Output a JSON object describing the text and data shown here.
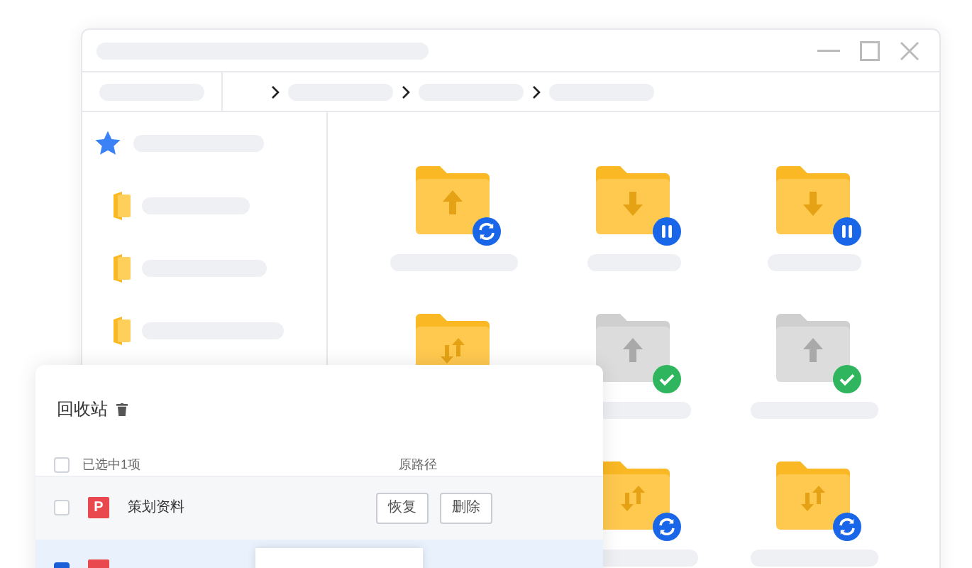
{
  "sidebar": {
    "items": [
      {
        "kind": "starred"
      },
      {
        "kind": "folder"
      },
      {
        "kind": "folder"
      },
      {
        "kind": "folder"
      }
    ]
  },
  "folders": [
    {
      "kind": "upload",
      "syncing": true,
      "paused": false,
      "done": false
    },
    {
      "kind": "download",
      "syncing": false,
      "paused": true,
      "done": false
    },
    {
      "kind": "download",
      "syncing": false,
      "paused": true,
      "done": false
    },
    {
      "kind": "transfer",
      "syncing": false,
      "paused": false,
      "done": false
    },
    {
      "kind": "upload",
      "syncing": false,
      "paused": false,
      "done": true
    },
    {
      "kind": "upload",
      "syncing": false,
      "paused": false,
      "done": true
    },
    {
      "kind": "transfer",
      "syncing": true,
      "paused": false,
      "done": false
    },
    {
      "kind": "transfer",
      "syncing": true,
      "paused": false,
      "done": false
    }
  ],
  "recycle_bin": {
    "title": "回收站",
    "header": {
      "label": "已选中1项",
      "checked": false,
      "path_label": "原路径"
    },
    "rows": [
      {
        "name": "策划资料",
        "badge": "P",
        "checked": false,
        "selected": false,
        "actions": [
          "恢复",
          "删除"
        ]
      },
      {
        "checked": true,
        "selected": true
      }
    ]
  }
}
